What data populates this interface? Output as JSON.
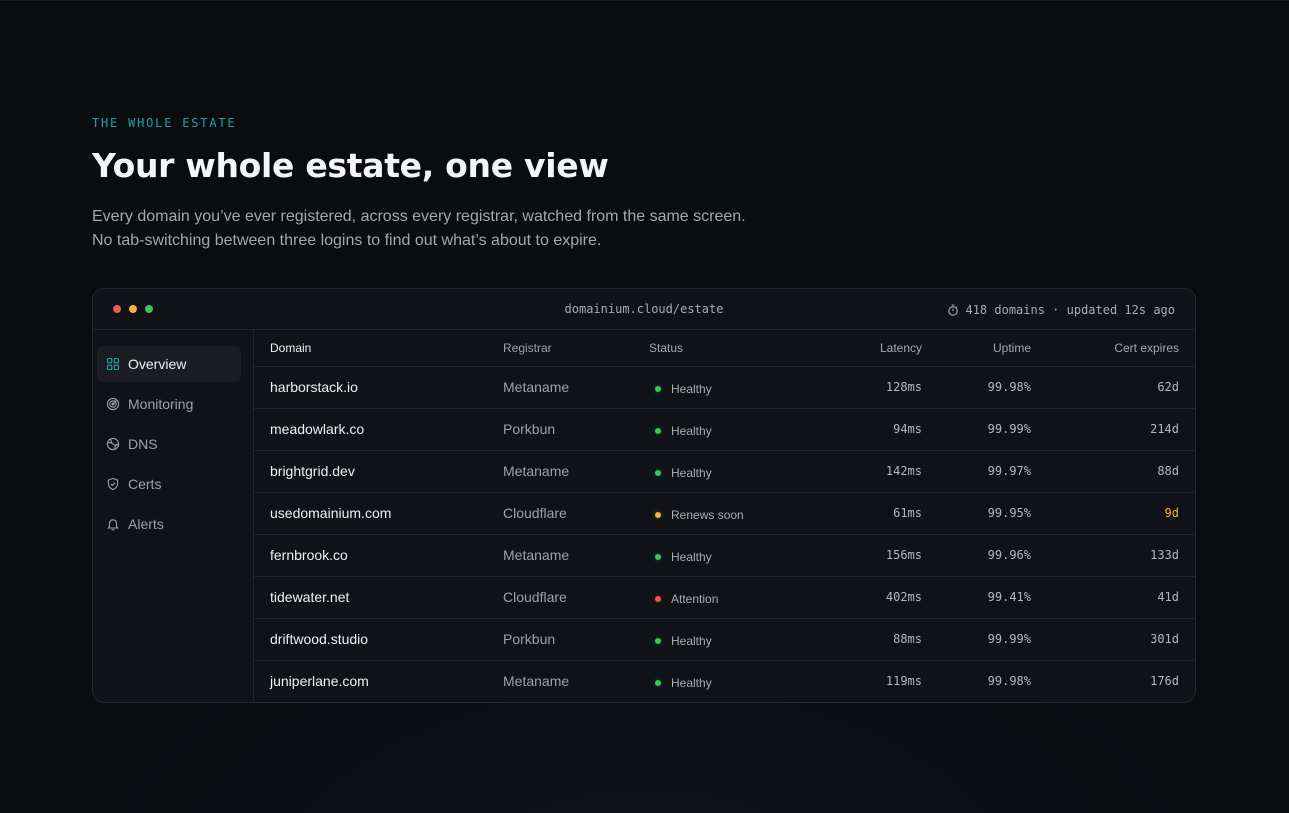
{
  "hero": {
    "eyebrow": "THE WHOLE ESTATE",
    "title": "Your whole estate, one view",
    "subtitle_line1": "Every domain you’ve ever registered, across every registrar, watched from the same screen.",
    "subtitle_line2": "No tab-switching between three logins to find out what’s about to expire."
  },
  "window": {
    "url": "domainium.cloud/estate",
    "meta": "418 domains · updated 12s ago",
    "meta_icon": "stopwatch-icon"
  },
  "sidebar": {
    "items": [
      {
        "label": "Overview",
        "icon": "grid-icon",
        "active": true
      },
      {
        "label": "Monitoring",
        "icon": "radar-icon",
        "active": false
      },
      {
        "label": "DNS",
        "icon": "globe-icon",
        "active": false
      },
      {
        "label": "Certs",
        "icon": "shield-icon",
        "active": false
      },
      {
        "label": "Alerts",
        "icon": "bell-icon",
        "active": false
      }
    ]
  },
  "table": {
    "columns": [
      "Domain",
      "Registrar",
      "Status",
      "Latency",
      "Uptime",
      "Cert expires"
    ],
    "rows": [
      {
        "domain": "harborstack.io",
        "registrar": "Metaname",
        "status": "Healthy",
        "latency": "128ms",
        "uptime": "99.98%",
        "cert": "62d"
      },
      {
        "domain": "meadowlark.co",
        "registrar": "Porkbun",
        "status": "Healthy",
        "latency": "94ms",
        "uptime": "99.99%",
        "cert": "214d"
      },
      {
        "domain": "brightgrid.dev",
        "registrar": "Metaname",
        "status": "Healthy",
        "latency": "142ms",
        "uptime": "99.97%",
        "cert": "88d"
      },
      {
        "domain": "usedomainium.com",
        "registrar": "Cloudflare",
        "status": "Renews soon",
        "latency": "61ms",
        "uptime": "99.95%",
        "cert": "9d"
      },
      {
        "domain": "fernbrook.co",
        "registrar": "Metaname",
        "status": "Healthy",
        "latency": "156ms",
        "uptime": "99.96%",
        "cert": "133d"
      },
      {
        "domain": "tidewater.net",
        "registrar": "Cloudflare",
        "status": "Attention",
        "latency": "402ms",
        "uptime": "99.41%",
        "cert": "41d"
      },
      {
        "domain": "driftwood.studio",
        "registrar": "Porkbun",
        "status": "Healthy",
        "latency": "88ms",
        "uptime": "99.99%",
        "cert": "301d"
      },
      {
        "domain": "juniperlane.com",
        "registrar": "Metaname",
        "status": "Healthy",
        "latency": "119ms",
        "uptime": "99.98%",
        "cert": "176d"
      }
    ]
  },
  "colors": {
    "accent": "#1fa3a0",
    "healthy": "#3fc55c",
    "warning": "#f0b43a",
    "danger": "#ef5a4c"
  }
}
